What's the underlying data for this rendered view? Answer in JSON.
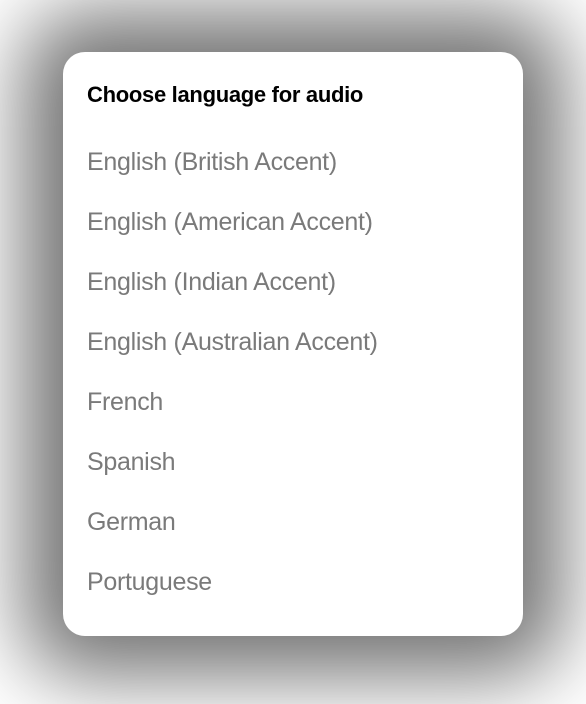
{
  "dialog": {
    "title": "Choose language for audio",
    "options": [
      "English (British Accent)",
      "English (American Accent)",
      "English (Indian Accent)",
      "English (Australian Accent)",
      "French",
      "Spanish",
      "German",
      "Portuguese"
    ]
  }
}
